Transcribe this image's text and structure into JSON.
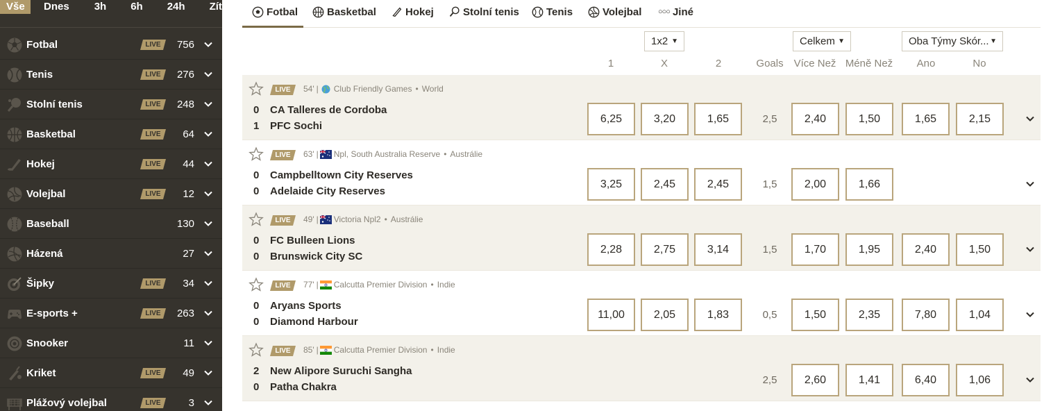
{
  "time_tabs": [
    "Vše",
    "Dnes",
    "3h",
    "6h",
    "24h",
    "Zítra"
  ],
  "sports": [
    {
      "name": "Fotbal",
      "live": "LIVE",
      "count": "756",
      "icon": "football-icon"
    },
    {
      "name": "Tenis",
      "live": "LIVE",
      "count": "276",
      "icon": "tennis-icon"
    },
    {
      "name": "Stolní tenis",
      "live": "LIVE",
      "count": "248",
      "icon": "table-tennis-icon"
    },
    {
      "name": "Basketbal",
      "live": "LIVE",
      "count": "64",
      "icon": "basketball-icon"
    },
    {
      "name": "Hokej",
      "live": "LIVE",
      "count": "44",
      "icon": "hockey-icon"
    },
    {
      "name": "Volejbal",
      "live": "LIVE",
      "count": "12",
      "icon": "volleyball-icon"
    },
    {
      "name": "Baseball",
      "live": "",
      "count": "130",
      "icon": "baseball-icon"
    },
    {
      "name": "Házená",
      "live": "",
      "count": "27",
      "icon": "handball-icon"
    },
    {
      "name": "Šipky",
      "live": "LIVE",
      "count": "34",
      "icon": "darts-icon"
    },
    {
      "name": "E-sports +",
      "live": "LIVE",
      "count": "263",
      "icon": "esports-icon"
    },
    {
      "name": "Snooker",
      "live": "",
      "count": "11",
      "icon": "snooker-icon"
    },
    {
      "name": "Kriket",
      "live": "LIVE",
      "count": "49",
      "icon": "cricket-icon"
    },
    {
      "name": "Plážový volejbal",
      "live": "LIVE",
      "count": "3",
      "icon": "beach-volleyball-icon"
    }
  ],
  "sport_tabs": [
    "Fotbal",
    "Basketbal",
    "Hokej",
    "Stolní tenis",
    "Tenis",
    "Volejbal",
    "Jiné"
  ],
  "dropdowns": {
    "market1": "1x2",
    "market2": "Celkem",
    "market3": "Oba Týmy Skór..."
  },
  "columns": [
    "1",
    "X",
    "2",
    "Goals",
    "Více Než",
    "Méně Než",
    "Ano",
    "No"
  ],
  "events": [
    {
      "live": "LIVE",
      "minute": "54'",
      "sep": "|",
      "league": "Club Friendly Games",
      "dot": "•",
      "country": "World",
      "flag": "world",
      "home": "CA Talleres de Cordoba",
      "away": "PFC Sochi",
      "home_score": "0",
      "away_score": "1",
      "odds": [
        "6,25",
        "3,20",
        "1,65"
      ],
      "goals": "2,5",
      "over": "2,40",
      "under": "1,50",
      "yes": "1,65",
      "no": "2,15"
    },
    {
      "live": "LIVE",
      "minute": "63'",
      "sep": "|",
      "league": "Npl, South Australia Reserve",
      "dot": "•",
      "country": "Austrálie",
      "flag": "australia",
      "home": "Campbelltown City Reserves",
      "away": "Adelaide City Reserves",
      "home_score": "0",
      "away_score": "0",
      "odds": [
        "3,25",
        "2,45",
        "2,45"
      ],
      "goals": "1,5",
      "over": "2,00",
      "under": "1,66",
      "yes": "",
      "no": ""
    },
    {
      "live": "LIVE",
      "minute": "49'",
      "sep": "|",
      "league": "Victoria Npl2",
      "dot": "•",
      "country": "Austrálie",
      "flag": "australia",
      "home": "FC Bulleen Lions",
      "away": "Brunswick City SC",
      "home_score": "0",
      "away_score": "0",
      "odds": [
        "2,28",
        "2,75",
        "3,14"
      ],
      "goals": "1,5",
      "over": "1,70",
      "under": "1,95",
      "yes": "2,40",
      "no": "1,50"
    },
    {
      "live": "LIVE",
      "minute": "77'",
      "sep": "|",
      "league": "Calcutta Premier Division",
      "dot": "•",
      "country": "Indie",
      "flag": "india",
      "home": "Aryans Sports",
      "away": "Diamond Harbour",
      "home_score": "0",
      "away_score": "0",
      "odds": [
        "11,00",
        "2,05",
        "1,83"
      ],
      "goals": "0,5",
      "over": "1,50",
      "under": "2,35",
      "yes": "7,80",
      "no": "1,04"
    },
    {
      "live": "LIVE",
      "minute": "85'",
      "sep": "|",
      "league": "Calcutta Premier Division",
      "dot": "•",
      "country": "Indie",
      "flag": "india",
      "home": "New Alipore Suruchi Sangha",
      "away": "Patha Chakra",
      "home_score": "2",
      "away_score": "0",
      "odds": [
        "",
        "",
        ""
      ],
      "goals": "2,5",
      "over": "2,60",
      "under": "1,41",
      "yes": "6,40",
      "no": "1,06"
    }
  ],
  "colors": {
    "sidebar_bg": "#36332d",
    "accent": "#b09a6a",
    "odd_border": "#b9a57c",
    "row_shade": "#f3f1ea"
  }
}
